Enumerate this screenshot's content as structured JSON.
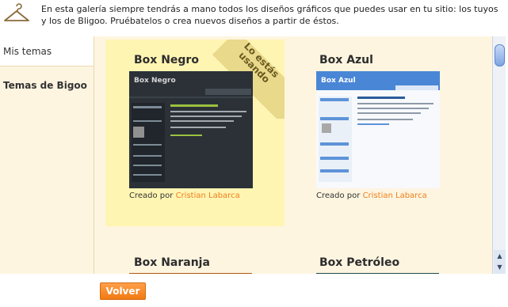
{
  "intro": {
    "text": "En esta galería siempre tendrás a mano todos los diseños gráficos que puedes usar en tu sitio: los tuyos y los de Bligoo. Pruébatelos o crea nuevos diseños a partir de éstos."
  },
  "sidebar": {
    "items": [
      {
        "label": "Mis temas"
      },
      {
        "label": "Temas de Bigoo"
      }
    ]
  },
  "gallery": {
    "themes": [
      {
        "name": "Box Negro",
        "created_prefix": "Creado por",
        "author": "Cristian Labarca",
        "badge": "Lo estás usando",
        "thumb_title": "Box Negro",
        "accent": "#1f262d"
      },
      {
        "name": "Box Azul",
        "created_prefix": "Creado por",
        "author": "Cristian Labarca",
        "thumb_title": "Box Azul",
        "accent": "#3f7fcf"
      },
      {
        "name": "Box Naranja",
        "accent": "#b25a12"
      },
      {
        "name": "Box Petróleo",
        "accent": "#1d4a4a"
      }
    ]
  },
  "actions": {
    "back_label": "Volver"
  }
}
